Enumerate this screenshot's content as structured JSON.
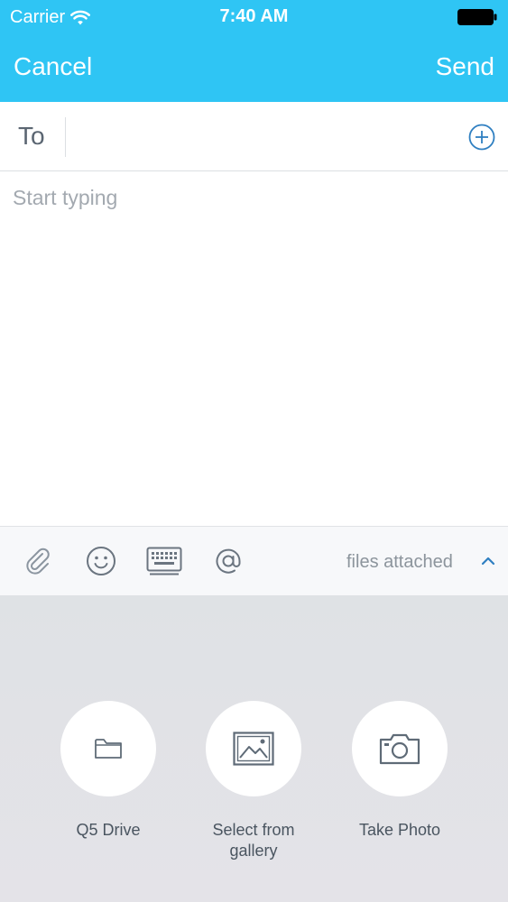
{
  "status_bar": {
    "carrier": "Carrier",
    "time": "7:40 AM"
  },
  "nav": {
    "cancel_label": "Cancel",
    "send_label": "Send"
  },
  "compose": {
    "to_label": "To",
    "to_value": "",
    "body_placeholder": "Start typing"
  },
  "toolbar": {
    "files_attached_label": "files attached"
  },
  "attach_options": [
    {
      "label": "Q5 Drive",
      "icon": "folder-icon"
    },
    {
      "label": "Select from gallery",
      "icon": "image-icon"
    },
    {
      "label": "Take Photo",
      "icon": "camera-icon"
    }
  ],
  "colors": {
    "accent": "#2fc5f4",
    "icon": "#5f6b77",
    "add_button": "#2f7fc1"
  }
}
